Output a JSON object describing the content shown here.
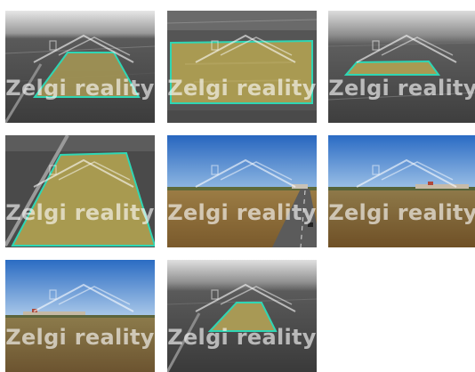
{
  "gallery": {
    "watermark": "Zelgi reality",
    "thumbnails": [
      {
        "alt": "aerial-grayscale-plot-1"
      },
      {
        "alt": "aerial-grayscale-plot-2"
      },
      {
        "alt": "aerial-grayscale-plot-3"
      },
      {
        "alt": "aerial-grayscale-plot-4"
      },
      {
        "alt": "field-road-view"
      },
      {
        "alt": "field-village-view"
      },
      {
        "alt": "field-village-view-2"
      },
      {
        "alt": "aerial-grayscale-plot-5"
      }
    ]
  },
  "colors": {
    "highlight_outline": "#2fd6b4",
    "field_fill": "#a99a52",
    "sky_blue": "#2f6fc4"
  }
}
